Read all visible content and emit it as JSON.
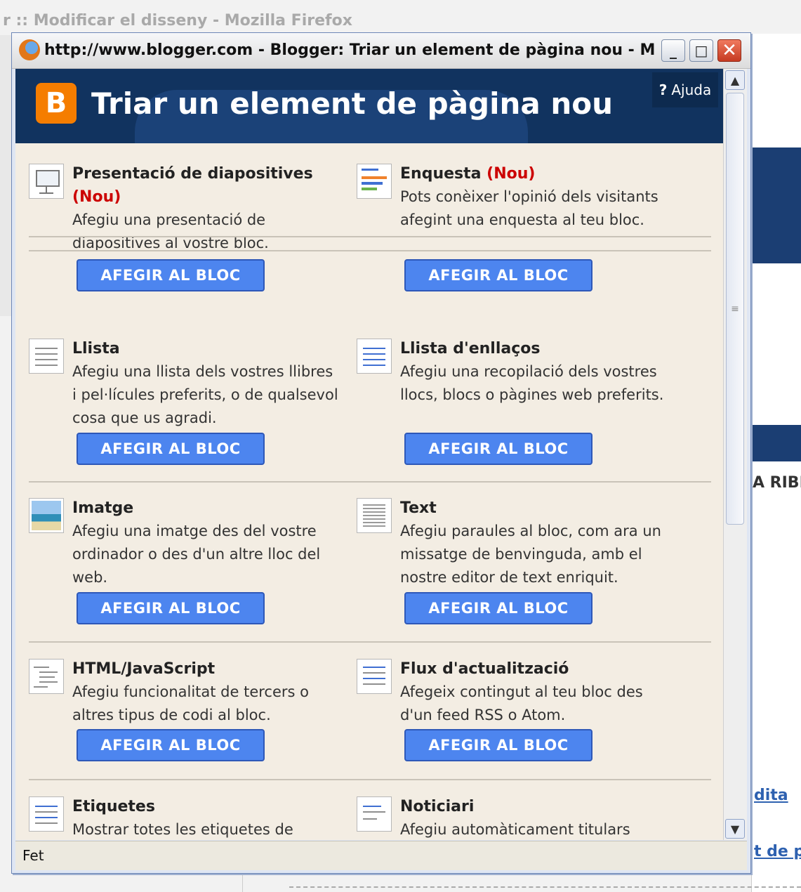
{
  "background_window": {
    "title": "r :: Modificar el disseny - Mozilla Firefox",
    "right_label": "A RIBI",
    "right_link_1": "dita",
    "right_link_2": "t de p"
  },
  "popup": {
    "window_title": "http://www.blogger.com - Blogger: Triar un element de pàgina nou - Mozil...",
    "controls": {
      "minimize": "_",
      "maximize": "□",
      "close": "✕"
    },
    "logo_letter": "B",
    "page_title": "Triar un element de pàgina nou",
    "help": {
      "icon": "?",
      "label": "Ajuda"
    },
    "add_button_label": "AFEGIR AL BLOC",
    "new_tag": "(Nou)",
    "status": "Fet",
    "scrollbar": {
      "up": "▲",
      "down": "▼",
      "grip": "≡"
    }
  },
  "items": [
    {
      "title": "Presentació de diapositives",
      "new": true,
      "desc": "Afegiu una presentació de diapositives al vostre bloc.",
      "icon": "slideshow-icon"
    },
    {
      "title": "Enquesta",
      "new": true,
      "desc": "Pots conèixer l'opinió dels visitants afegint una enquesta al teu bloc.",
      "icon": "poll-icon"
    },
    {
      "title": "Llista",
      "new": false,
      "desc": "Afegiu una llista dels vostres llibres i pel·lícules preferits, o de qualsevol cosa que us agradi.",
      "icon": "list-icon"
    },
    {
      "title": "Llista d'enllaços",
      "new": false,
      "desc": "Afegiu una recopilació dels vostres llocs, blocs o pàgines web preferits.",
      "icon": "link-list-icon"
    },
    {
      "title": "Imatge",
      "new": false,
      "desc": "Afegiu una imatge des del vostre ordinador o des d'un altre lloc del web.",
      "icon": "image-icon"
    },
    {
      "title": "Text",
      "new": false,
      "desc": "Afegiu paraules al bloc, com ara un missatge de benvinguda, amb el nostre editor de text enriquit.",
      "icon": "text-icon"
    },
    {
      "title": "HTML/JavaScript",
      "new": false,
      "desc": "Afegiu funcionalitat de tercers o altres tipus de codi al bloc.",
      "icon": "html-javascript-icon"
    },
    {
      "title": "Flux d'actualització",
      "new": false,
      "desc": "Afegeix contingut al teu bloc des d'un feed RSS o Atom.",
      "icon": "feed-icon"
    },
    {
      "title": "Etiquetes",
      "new": false,
      "desc": "Mostrar totes les etiquetes de",
      "icon": "labels-icon"
    },
    {
      "title": "Noticiari",
      "new": false,
      "desc": "Afegiu automàticament titulars",
      "icon": "newsreel-icon"
    }
  ]
}
